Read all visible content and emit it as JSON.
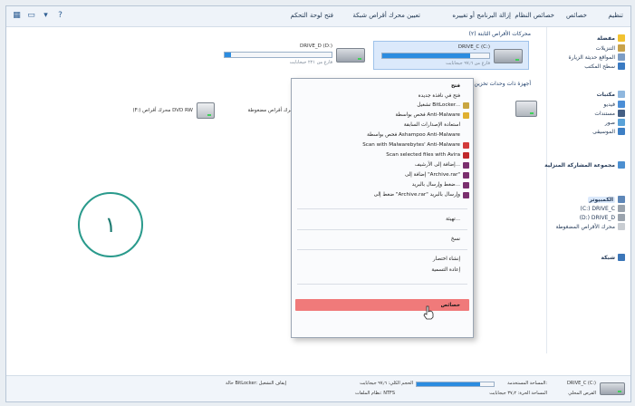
{
  "toolbar": {
    "commands": [
      "تنظيم",
      "خصائص",
      "خصائص النظام",
      "إزالة البرنامج أو تغييره",
      "تعيين محرك أقراص شبكة",
      "فتح لوحة التحكم"
    ]
  },
  "nav": {
    "favorites": "مفضلة",
    "downloads": "التنزيلات",
    "recent_places": "المواقع حديثة الزيارة",
    "desktop": "سطح المكتب",
    "libraries": "مكتبات",
    "videos": "فيديو",
    "documents": "مستندات",
    "pictures": "صور",
    "music": "الموسيقى",
    "homegroup": "مجموعة المشاركة المنزلية",
    "computer": "الكمبيوتر",
    "drive_c": "(C:) DRIVE_C",
    "drive_d": "(D:) DRIVE_D",
    "dvd": "محرك الأقراص المضغوطة",
    "network": "شبكة"
  },
  "content": {
    "hard_disks_title": "محركات الأقراص الثابتة (٢)",
    "removable_title": "أجهزة ذات وحدات تخزين قابلة للإزالة",
    "drive_c_name": "DRIVE_C (C:)",
    "drive_d_name": "DRIVE_D (D:)",
    "drive_c_free": "فارغ من ٩٧٫٦ جيجابايت",
    "drive_d_free": "فارغ من ٢٢١ جيجابايت",
    "drive_c_fill": 0.82,
    "drive_d_fill": 0.06,
    "dvd_label": "(F:) محرك أقراص DVD RW",
    "removable_label": "محرك أقراص مضغوطة"
  },
  "context_menu": {
    "items": [
      "فتح",
      "فتح في نافذة جديدة",
      "تشغيل BitLocker...",
      "فحص بواسطة Anti-Malware",
      "استعادة الإصدارات السابقة",
      "فحص بواسطة Ashampoo Anti-Malware",
      "Scan with Malwarebytes' Anti-Malware",
      "Scan selected files with Avira",
      "إضافة إلى الأرشيف...",
      "إضافة إلى \"Archive.rar\"",
      "ضغط وإرسال بالبريد...",
      "ضغط إلى \"Archive.rar\" وإرسال بالبريد",
      "تهيئة...",
      "نسخ",
      "إنشاء اختصار",
      "إعادة التسمية",
      "خصائص"
    ]
  },
  "details": {
    "drive_name": "DRIVE_C (C:)",
    "drive_type": "القرص المحلي",
    "space_used_label": "المساحة المستخدمة:",
    "free_space": "المساحة الحرة: ٣٧٫٢ جيجابايت",
    "total_size": "الحجم الكلي: ٩٧٫٦ جيجابايت",
    "file_system": "نظام الملفات: NTFS",
    "bitlocker": "حالة BitLocker: إيقاف التشغيل"
  },
  "annotation": {
    "number": "١"
  },
  "colors": {
    "accent": "#2b8ce0",
    "menu_highlight": "#f07a7a",
    "annotation_ring": "#2a9a8c"
  }
}
